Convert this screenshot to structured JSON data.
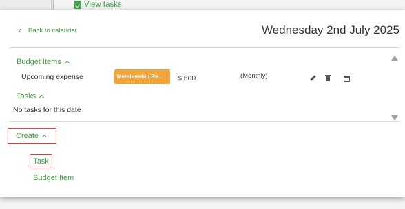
{
  "background": {
    "view_tasks_label": "View tasks"
  },
  "modal": {
    "back_label": "Back to calendar",
    "date_title": "Wednesday 2nd July 2025",
    "budget_items": {
      "header": "Budget Items",
      "rows": [
        {
          "name": "Upcoming expense",
          "category": "Membership Re...",
          "amount": "$ 600",
          "frequency": "(Monthly)"
        }
      ]
    },
    "tasks": {
      "header": "Tasks",
      "empty_text": "No tasks for this date"
    },
    "create": {
      "label": "Create",
      "options": [
        "Task",
        "Budget Item"
      ]
    }
  },
  "colors": {
    "accent_green": "#43a047",
    "badge_orange": "#f2a53a",
    "highlight_red": "#e53935"
  },
  "icons": [
    "check-doc-icon",
    "chevron-left-icon",
    "chevron-up-icon",
    "edit-icon",
    "trash-icon",
    "calendar-icon",
    "scroll-up-icon",
    "scroll-down-icon"
  ]
}
